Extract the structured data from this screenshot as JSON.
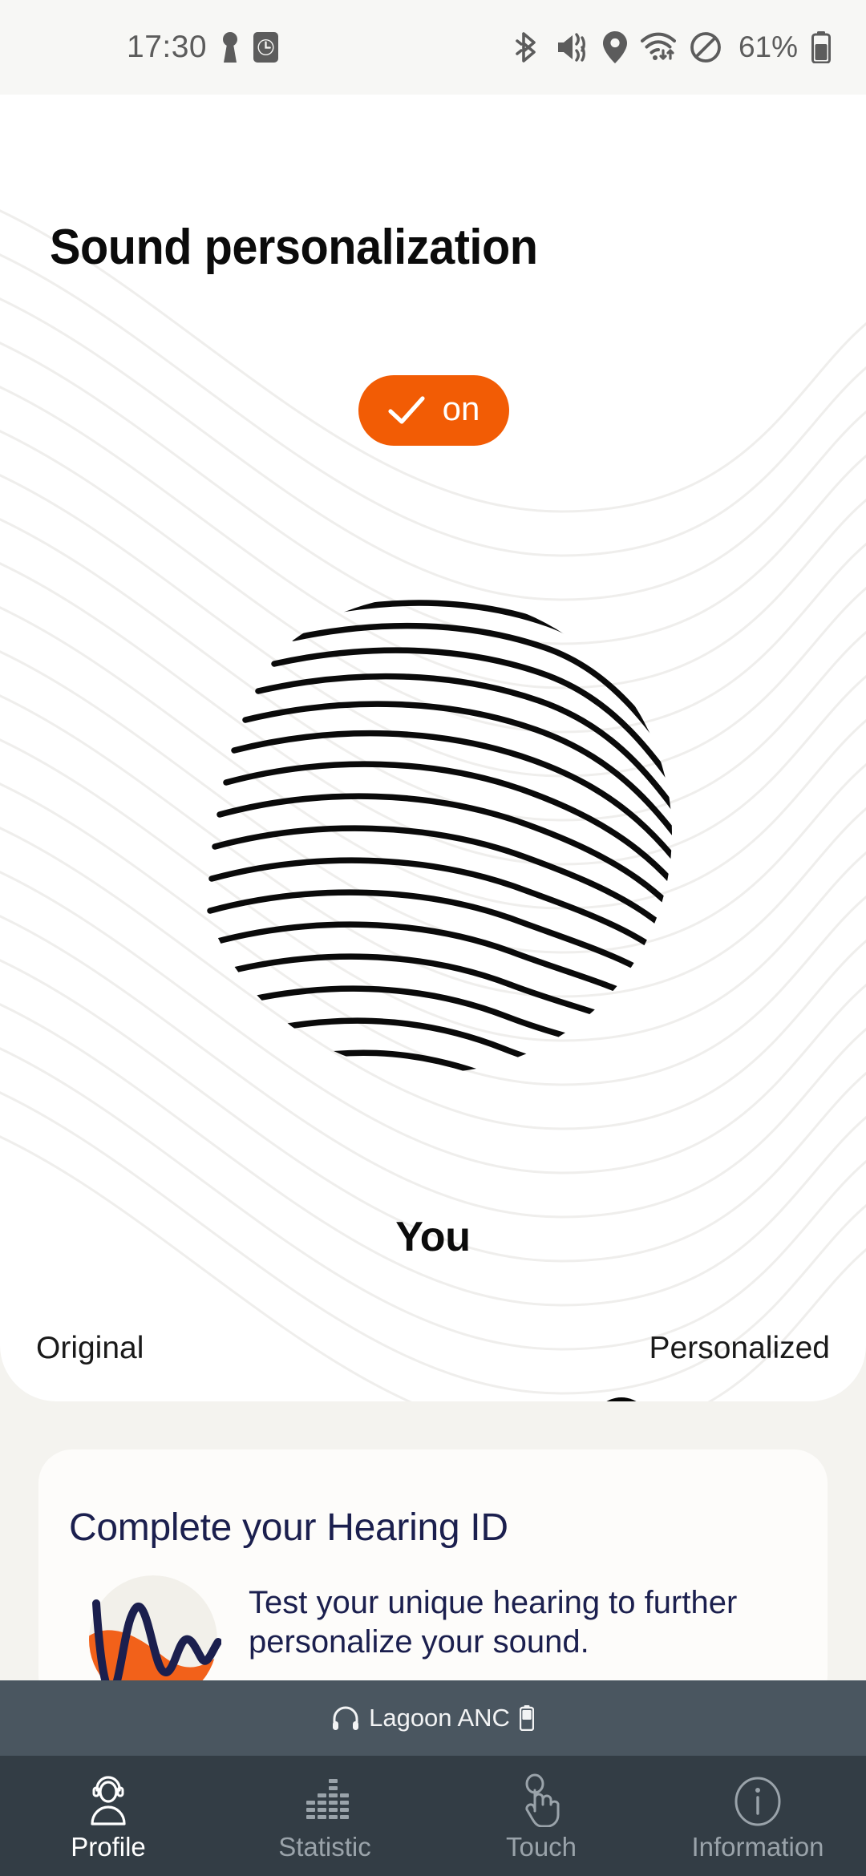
{
  "status_bar": {
    "time": "17:30",
    "battery_percent": "61%",
    "left_icons": [
      "keyhole-app-icon",
      "alarm-clock-icon"
    ],
    "right_icons": [
      "bluetooth-icon",
      "vibrate-mute-icon",
      "location-icon",
      "wifi-icon",
      "do-not-disturb-icon",
      "battery-icon"
    ]
  },
  "header": {
    "title": "Sound personalization"
  },
  "toggle": {
    "label": "on",
    "state": "on",
    "icon": "check-icon",
    "color": "#F25C05"
  },
  "fingerprint": {
    "icon": "fingerprint-graphic",
    "line_count": 24
  },
  "profile": {
    "name": "You"
  },
  "slider": {
    "left_label": "Original",
    "right_label": "Personalized",
    "value_percent": 78,
    "track_color": "#EFEFEF",
    "fill_color": "#F2611A",
    "thumb_color": "#050505"
  },
  "hearing_card": {
    "title": "Complete your Hearing ID",
    "description": "Test your unique hearing to further personalize your sound.",
    "icon": "hearing-waveform-icon",
    "accent_color": "#F2611A",
    "text_color": "#1B1F4E"
  },
  "device_bar": {
    "name": "Lagoon ANC",
    "left_icon": "headphones-icon",
    "right_icon": "battery-icon",
    "background": "#4A5660"
  },
  "tabs": [
    {
      "label": "Profile",
      "icon": "profile-headset-icon",
      "active": true
    },
    {
      "label": "Statistic",
      "icon": "equalizer-bars-icon",
      "active": false
    },
    {
      "label": "Touch",
      "icon": "touch-hand-icon",
      "active": false
    },
    {
      "label": "Information",
      "icon": "info-circle-icon",
      "active": false
    }
  ],
  "theme": {
    "orange": "#F25C05",
    "navy": "#1B1F4E",
    "page_bg": "#F4F3EF",
    "panel_bg": "#FFFFFF",
    "tabbar_bg": "#333D45"
  }
}
